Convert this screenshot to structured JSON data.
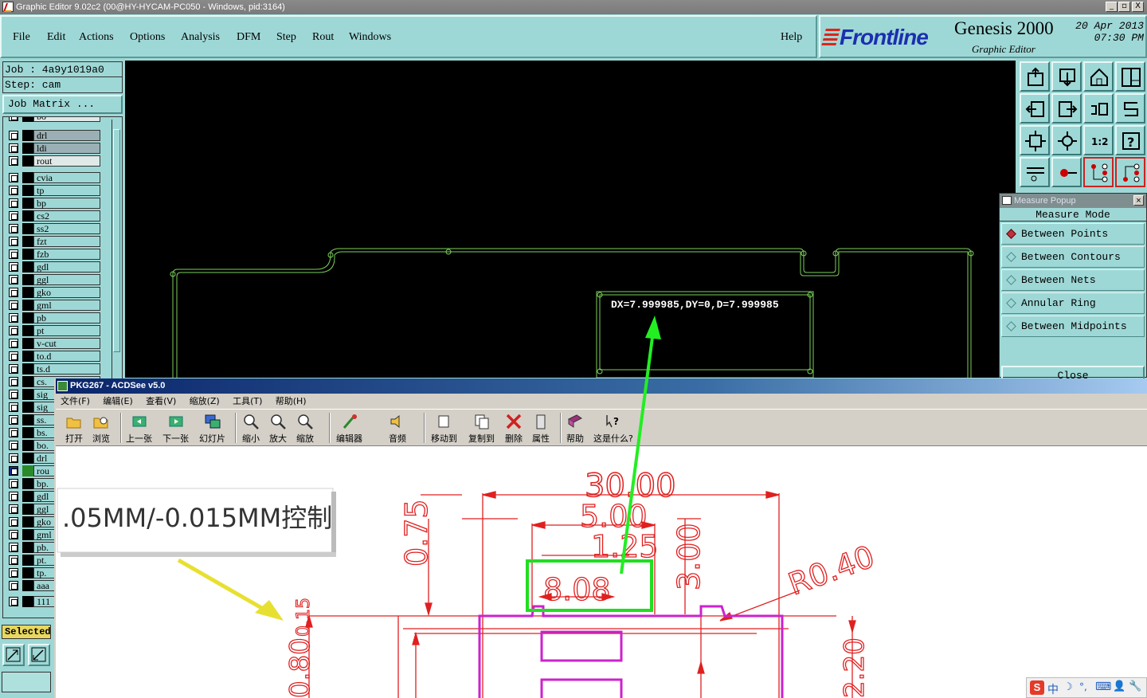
{
  "window": {
    "title": "Graphic Editor 9.02c2 (00@HY-HYCAM-PC050 - Windows, pid:3164)",
    "buttons": [
      "_",
      "▫",
      "X"
    ]
  },
  "menu": [
    "File",
    "Edit",
    "Actions",
    "Options",
    "Analysis",
    "DFM",
    "Step",
    "Rout",
    "Windows"
  ],
  "help_label": "Help",
  "brand": {
    "logo": "Frontline",
    "product": "Genesis 2000",
    "subtitle": "Graphic Editor",
    "date": "20 Apr 2013",
    "time": "07:30 PM"
  },
  "job": {
    "job_line": "Job : 4a9y1019a0",
    "step_line": "Step: cam",
    "matrix_button": "Job Matrix ..."
  },
  "layers_top_partial": "bo",
  "layers": [
    {
      "name": "drl",
      "style": "gray"
    },
    {
      "name": "ldi",
      "style": "gray"
    },
    {
      "name": "rout",
      "style": "white"
    },
    {
      "name": "cvia",
      "style": "normal"
    },
    {
      "name": "tp",
      "style": "normal"
    },
    {
      "name": "bp",
      "style": "normal"
    },
    {
      "name": "cs2",
      "style": "normal"
    },
    {
      "name": "ss2",
      "style": "normal"
    },
    {
      "name": "fzt",
      "style": "normal"
    },
    {
      "name": "fzb",
      "style": "normal"
    },
    {
      "name": "gdl",
      "style": "normal"
    },
    {
      "name": "ggl",
      "style": "normal"
    },
    {
      "name": "gko",
      "style": "normal"
    },
    {
      "name": "gml",
      "style": "normal"
    },
    {
      "name": "pb",
      "style": "normal"
    },
    {
      "name": "pt",
      "style": "normal"
    },
    {
      "name": "v-cut",
      "style": "normal"
    },
    {
      "name": "to.d",
      "style": "normal"
    },
    {
      "name": "ts.d",
      "style": "normal"
    },
    {
      "name": "cs.",
      "style": "normal"
    },
    {
      "name": "sig",
      "style": "normal"
    },
    {
      "name": "sig",
      "style": "normal"
    },
    {
      "name": "ss.",
      "style": "normal"
    },
    {
      "name": "bs.",
      "style": "normal"
    },
    {
      "name": "bo.",
      "style": "normal"
    },
    {
      "name": "drl",
      "style": "normal"
    },
    {
      "name": "rou",
      "style": "sel"
    },
    {
      "name": "bp.",
      "style": "normal"
    },
    {
      "name": "gdl",
      "style": "normal"
    },
    {
      "name": "ggl",
      "style": "normal"
    },
    {
      "name": "gko",
      "style": "normal"
    },
    {
      "name": "gml",
      "style": "normal"
    },
    {
      "name": "pb.",
      "style": "normal"
    },
    {
      "name": "pt.",
      "style": "normal"
    },
    {
      "name": "tp.",
      "style": "normal"
    },
    {
      "name": "aaa",
      "style": "normal"
    },
    {
      "name": "111",
      "style": "normal"
    }
  ],
  "selected_label": "Selected",
  "canvas": {
    "measure_text": "DX=7.999985,DY=0,D=7.999985"
  },
  "measure_popup": {
    "title": "Measure Popup",
    "mode_label": "Measure Mode",
    "options": [
      {
        "label": "Between Points",
        "selected": true
      },
      {
        "label": "Between Contours",
        "selected": false
      },
      {
        "label": "Between Nets",
        "selected": false
      },
      {
        "label": "Annular Ring",
        "selected": false
      },
      {
        "label": "Between Midpoints",
        "selected": false
      }
    ],
    "close_label": "Close"
  },
  "acdsee": {
    "title": "PKG267 - ACDSee v5.0",
    "menu": [
      "文件(F)",
      "编辑(E)",
      "查看(V)",
      "缩放(Z)",
      "工具(T)",
      "帮助(H)"
    ],
    "toolbar": [
      "打开",
      "浏览",
      "上一张",
      "下一张",
      "幻灯片",
      "缩小",
      "放大",
      "缩放",
      "编辑器",
      "音频",
      "移动到",
      "复制到",
      "删除",
      "属性",
      "帮助",
      "这是什么?"
    ],
    "drawing": {
      "dim_30": "30.00",
      "dim_5": "5.00",
      "dim_125": "1.25",
      "dim_300": "3.00",
      "dim_075": "0.75",
      "dim_808": "8.08",
      "dim_r040": "R0.40",
      "dim_080": "0.80",
      "dim_015": "0.15",
      "dim_220": "2.20",
      "note": ".05MM/-0.015MM控制"
    }
  },
  "tray": [
    "S",
    "中",
    "☽",
    "°,",
    "⌨",
    "👤",
    "🔧"
  ],
  "colors": {
    "panel": "#9ed8d6",
    "canvas": "#000000",
    "outline": "#7ccf5a",
    "magenta": "#cc22cc",
    "dimension_red": "#e02020",
    "highlight_green": "#22dd22"
  }
}
